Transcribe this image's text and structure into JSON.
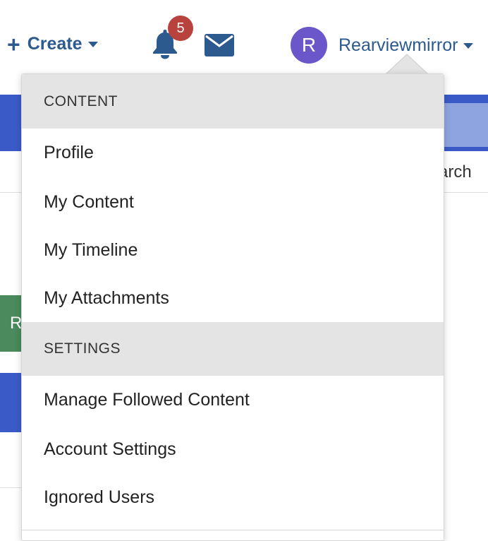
{
  "header": {
    "create_icon": "plus-icon",
    "create_label": "Create",
    "notifications_count": "5",
    "notifications_icon": "bell-icon",
    "messages_icon": "envelope-icon",
    "avatar_initial": "R",
    "username": "Rearviewmirror",
    "accent_color": "#2d5a8e",
    "badge_color": "#b8423c",
    "avatar_color": "#6b57c9"
  },
  "background": {
    "search_fragment": "arch",
    "button_fragment": "R"
  },
  "menu": {
    "content_header": "CONTENT",
    "content_items": [
      "Profile",
      "My Content",
      "My Timeline",
      "My Attachments"
    ],
    "settings_header": "SETTINGS",
    "settings_items": [
      "Manage Followed Content",
      "Account Settings",
      "Ignored Users"
    ]
  }
}
